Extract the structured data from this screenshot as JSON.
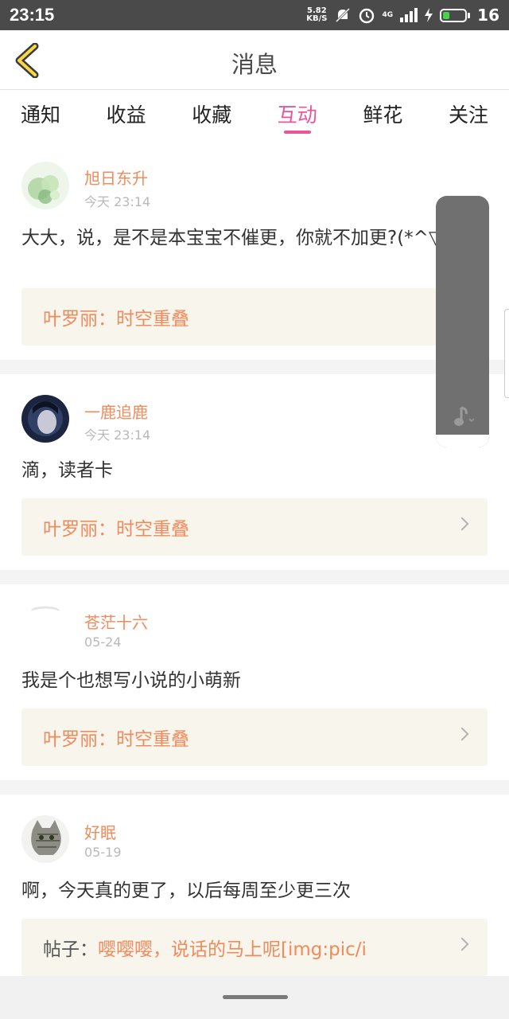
{
  "status": {
    "time": "23:15",
    "speed_value": "5.82",
    "speed_unit": "KB/S",
    "network": "4G",
    "battery": "16"
  },
  "header": {
    "title": "消息"
  },
  "tabs": [
    {
      "label": "通知"
    },
    {
      "label": "收益"
    },
    {
      "label": "收藏"
    },
    {
      "label": "互动",
      "active": true
    },
    {
      "label": "鲜花"
    },
    {
      "label": "关注"
    }
  ],
  "messages": [
    {
      "user": "旭日东升",
      "date": "今天 23:14",
      "content": "大大，说，是不是本宝宝不催更，你就不加更?(*^▽^*)",
      "ref_prefix": "",
      "ref": "叶罗丽：时空重叠"
    },
    {
      "user": "一鹿追鹿",
      "date": "今天 23:14",
      "content": "滴，读者卡",
      "ref_prefix": "",
      "ref": "叶罗丽：时空重叠"
    },
    {
      "user": "苍茫十六",
      "date": "05-24",
      "content": "我是个也想写小说的小萌新",
      "ref_prefix": "",
      "ref": "叶罗丽：时空重叠"
    },
    {
      "user": "好眠",
      "date": "05-19",
      "content": "啊，今天真的更了，以后每周至少更三次",
      "ref_prefix": "帖子：",
      "ref": "嘤嘤嘤，说话的马上呢[img:pic/i"
    }
  ],
  "colors": {
    "accent": "#e8559a",
    "username": "#ef8b5c",
    "ref_bg": "#f7f5ec"
  }
}
